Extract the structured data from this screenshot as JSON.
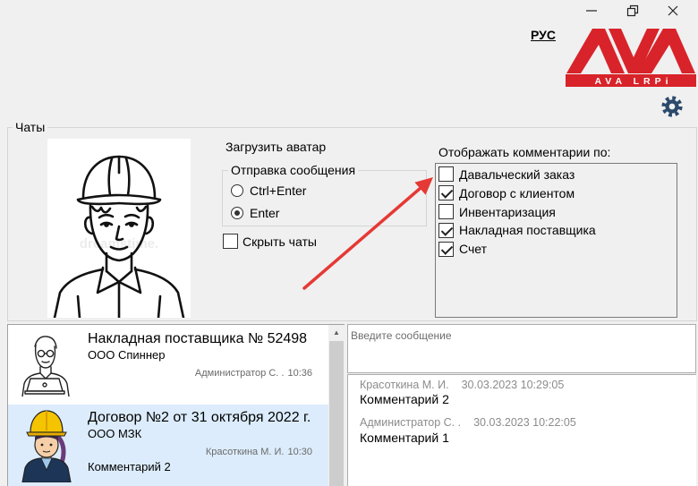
{
  "window": {
    "controls": {
      "minimize": "minimize-icon",
      "restore": "restore-icon",
      "close": "close-icon"
    }
  },
  "colors": {
    "brand": "#d8232a",
    "selection": "#dcecfc",
    "annotation": "#e53935",
    "icon": "#2c4a6b"
  },
  "header": {
    "language": "РУС",
    "logo_text": "AVA LRPi",
    "settings_icon": "gear-icon"
  },
  "chats_group": {
    "title": "Чаты",
    "avatar": {
      "watermark": "dreamstime."
    },
    "upload_avatar": "Загрузить аватар",
    "send_group": {
      "title": "Отправка сообщения",
      "options": [
        {
          "label": "Ctrl+Enter",
          "selected": false
        },
        {
          "label": "Enter",
          "selected": true
        }
      ]
    },
    "hide_chats": {
      "label": "Скрыть чаты",
      "checked": false
    },
    "filter": {
      "title": "Отображать комментарии по:",
      "items": [
        {
          "label": "Давальческий заказ",
          "checked": false
        },
        {
          "label": "Договор с клиентом",
          "checked": true
        },
        {
          "label": "Инвентаризация",
          "checked": false
        },
        {
          "label": "Накладная поставщика",
          "checked": true
        },
        {
          "label": "Счет",
          "checked": true
        }
      ]
    }
  },
  "chat_list": [
    {
      "title": "Накладная поставщика № 52498",
      "company": "ООО Спиннер",
      "author": "Администратор С. .",
      "time": "10:36",
      "selected": false
    },
    {
      "title": "Договор №2 от 31 октября 2022 г.",
      "company": "ООО МЗК",
      "author": "Красоткина М. И.",
      "time": "10:30",
      "last_comment": "Комментарий 2",
      "selected": true
    }
  ],
  "message_input": {
    "placeholder": "Введите сообщение",
    "value": ""
  },
  "comments": [
    {
      "author": "Красоткина М. И.",
      "datetime": "30.03.2023 10:29:05",
      "text": "Комментарий 2"
    },
    {
      "author": "Администратор С. .",
      "datetime": "30.03.2023 10:22:05",
      "text": "Комментарий 1"
    }
  ]
}
